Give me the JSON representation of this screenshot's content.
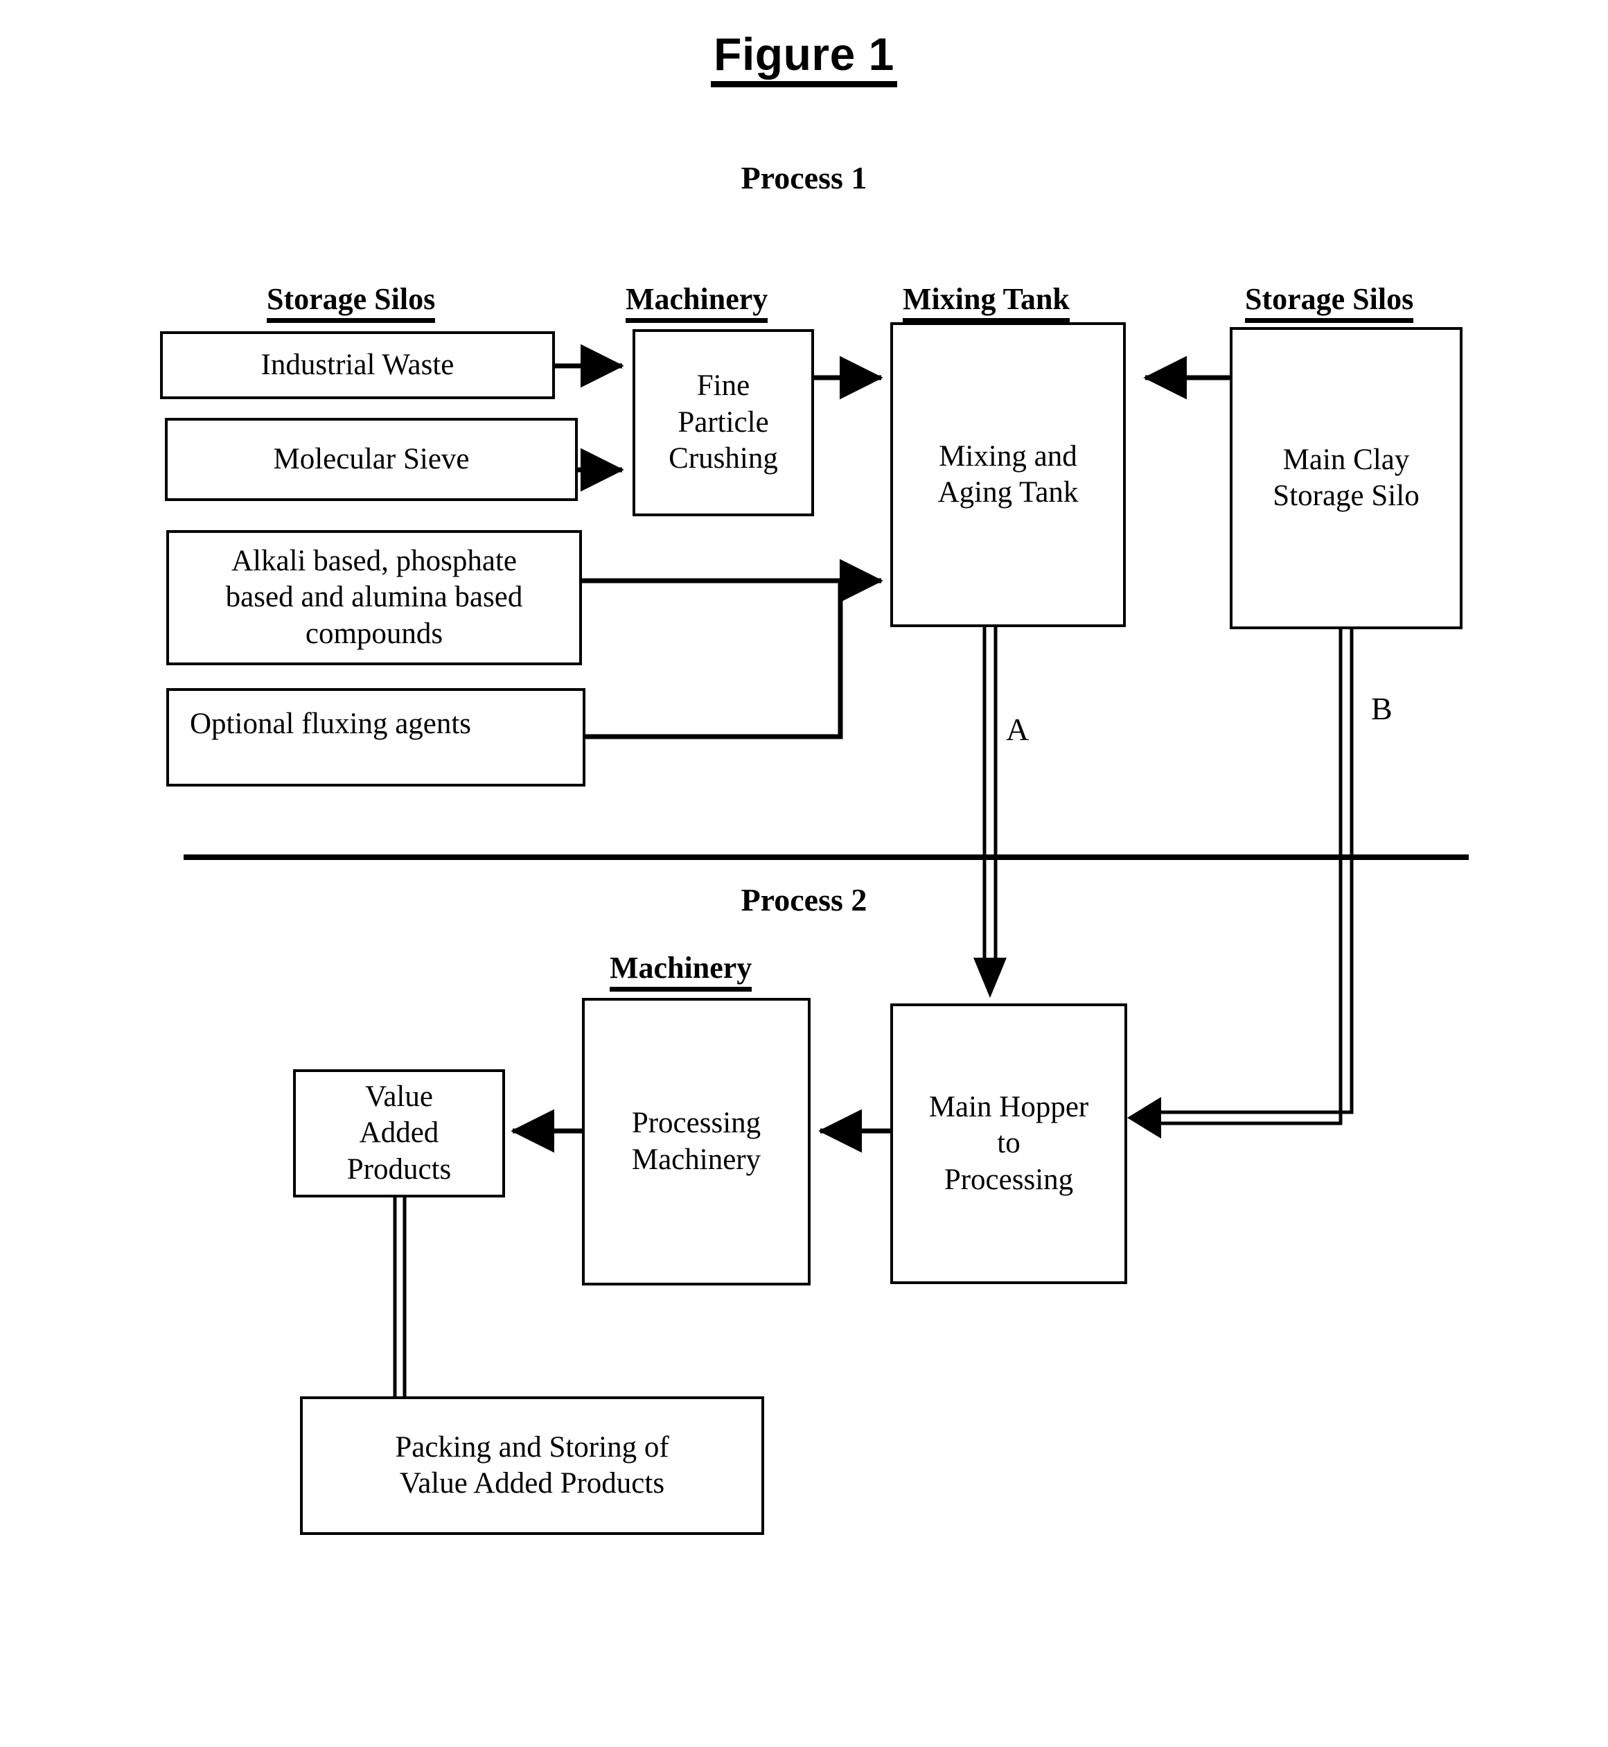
{
  "figure": {
    "title": "Figure 1",
    "process_1_label": "Process 1",
    "process_2_label": "Process 2"
  },
  "column_headers": [
    {
      "id": "storage-silos-left",
      "label": "Storage Silos"
    },
    {
      "id": "machinery-top",
      "label": "Machinery"
    },
    {
      "id": "mixing-tank",
      "label": "Mixing Tank"
    },
    {
      "id": "storage-silos-right",
      "label": "Storage Silos"
    },
    {
      "id": "machinery-bottom",
      "label": "Machinery"
    }
  ],
  "nodes": {
    "industrial_waste": "Industrial Waste",
    "molecular_sieve": "Molecular Sieve",
    "compounds": "Alkali based, phosphate\nbased and alumina based\ncompounds",
    "optional_flux": "Optional fluxing agents",
    "fine_crush": "Fine\nParticle\nCrushing",
    "mixing_tank": "Mixing and\nAging Tank",
    "clay_silo": "Main Clay\nStorage Silo",
    "value_added": "Value\nAdded\nProducts",
    "processing_machinery": "Processing\nMachinery",
    "main_hopper": "Main Hopper\nto\nProcessing",
    "packing": "Packing and Storing of\nValue Added Products"
  },
  "connector_labels": {
    "a": "A",
    "b": "B"
  },
  "colors": {
    "ink": "#000000",
    "paper": "#ffffff"
  },
  "chart_data": {
    "type": "diagram",
    "title": "Figure 1",
    "subtitle": "Process 1 / Process 2 material flow block diagram",
    "groups": [
      {
        "name": "Process 1",
        "members": [
          "Industrial Waste",
          "Molecular Sieve",
          "Alkali based, phosphate based and alumina based compounds",
          "Optional fluxing agents",
          "Fine Particle Crushing",
          "Mixing and Aging Tank",
          "Main Clay Storage Silo"
        ]
      },
      {
        "name": "Process 2",
        "members": [
          "Main Hopper to Processing",
          "Processing Machinery",
          "Value Added Products",
          "Packing and Storing of Value Added Products"
        ]
      }
    ],
    "edges": [
      {
        "from": "Industrial Waste",
        "to": "Fine Particle Crushing",
        "style": "single-arrow"
      },
      {
        "from": "Molecular Sieve",
        "to": "Fine Particle Crushing",
        "style": "single-arrow"
      },
      {
        "from": "Fine Particle Crushing",
        "to": "Mixing and Aging Tank",
        "style": "single-arrow"
      },
      {
        "from": "Alkali based, phosphate based and alumina based compounds",
        "to": "Mixing and Aging Tank",
        "style": "single-arrow"
      },
      {
        "from": "Optional fluxing agents",
        "to": "Mixing and Aging Tank",
        "style": "single-arrow"
      },
      {
        "from": "Main Clay Storage Silo",
        "to": "Mixing and Aging Tank",
        "style": "single-arrow"
      },
      {
        "from": "Mixing and Aging Tank",
        "to": "Main Hopper to Processing",
        "label": "A",
        "style": "double-line-arrow"
      },
      {
        "from": "Main Clay Storage Silo",
        "to": "Main Hopper to Processing",
        "label": "B",
        "style": "double-line-arrow"
      },
      {
        "from": "Main Hopper to Processing",
        "to": "Processing Machinery",
        "style": "single-arrow"
      },
      {
        "from": "Processing Machinery",
        "to": "Value Added Products",
        "style": "single-arrow"
      },
      {
        "from": "Value Added Products",
        "to": "Packing and Storing of Value Added Products",
        "style": "double-line"
      }
    ]
  }
}
